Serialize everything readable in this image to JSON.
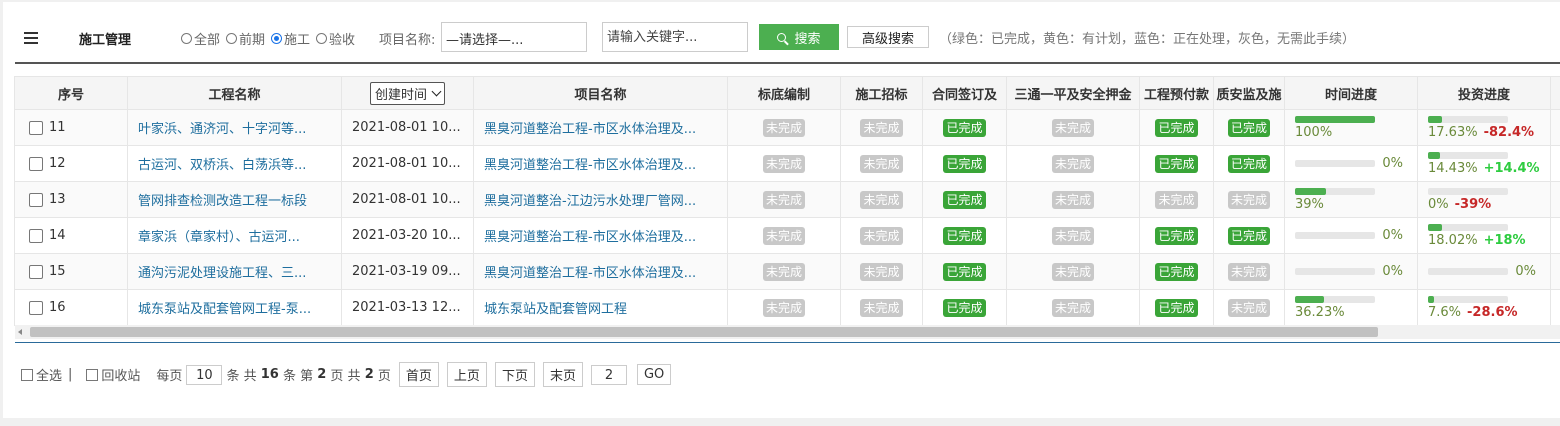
{
  "toolbar": {
    "title": "施工管理",
    "radios": [
      {
        "label": "全部",
        "checked": false
      },
      {
        "label": "前期",
        "checked": false
      },
      {
        "label": "施工",
        "checked": true
      },
      {
        "label": "验收",
        "checked": false
      }
    ],
    "project_label": "项目名称:",
    "project_select": "—请选择—...",
    "keyword_placeholder": "请输入关键字...",
    "search_label": "搜索",
    "advanced_label": "高级搜索",
    "legend": "（绿色：已完成，黄色：有计划，蓝色：正在处理，灰色，无需此手续）"
  },
  "columns": {
    "idx": "序号",
    "project": "工程名称",
    "sort_select": "创建时间",
    "item": "项目名称",
    "c1": "标底编制",
    "c2": "施工招标",
    "c3": "合同签订及",
    "c4": "三通一平及安全押金",
    "c5": "工程预付款",
    "c6": "质安监及施",
    "time": "时间进度",
    "invest": "投资进度"
  },
  "status_labels": {
    "done": "已完成",
    "todo": "未完成"
  },
  "colors": {
    "green": "#3aa538",
    "gray": "#c8c8c8",
    "bar": "#4caf50",
    "neg": "#c62828",
    "pos": "#2ecc40"
  },
  "rows": [
    {
      "idx": "11",
      "project": "叶家浜、通济河、十字河等...",
      "date": "2021-08-01 10...",
      "item": "黑臭河道整治工程-市区水体治理及...",
      "status": [
        "todo",
        "todo",
        "done",
        "todo",
        "done",
        "done"
      ],
      "time_fill": 1.0,
      "time_text": "100%",
      "time_pos": "under",
      "inv_fill": 0.1763,
      "inv_text": "17.63%",
      "delta": "-82.4%",
      "delta_sign": "neg"
    },
    {
      "idx": "12",
      "project": "古运河、双桥浜、白荡浜等...",
      "date": "2021-08-01 10...",
      "item": "黑臭河道整治工程-市区水体治理及...",
      "status": [
        "todo",
        "todo",
        "done",
        "todo",
        "done",
        "done"
      ],
      "time_fill": 0.0,
      "time_text": "0%",
      "time_pos": "right",
      "inv_fill": 0.1443,
      "inv_text": "14.43%",
      "delta": "+14.4%",
      "delta_sign": "pos"
    },
    {
      "idx": "13",
      "project": "管网排查检测改造工程一标段",
      "date": "2021-08-01 10...",
      "item": "黑臭河道整治-江边污水处理厂管网...",
      "status": [
        "todo",
        "todo",
        "done",
        "todo",
        "todo",
        "todo"
      ],
      "time_fill": 0.39,
      "time_text": "39%",
      "time_pos": "under",
      "inv_fill": 0.0,
      "inv_text": "0%",
      "delta": "-39%",
      "delta_sign": "neg"
    },
    {
      "idx": "14",
      "project": "章家浜（章家村）、古运河...",
      "date": "2021-03-20 10...",
      "item": "黑臭河道整治工程-市区水体治理及...",
      "status": [
        "todo",
        "todo",
        "done",
        "todo",
        "done",
        "done"
      ],
      "time_fill": 0.0,
      "time_text": "0%",
      "time_pos": "right",
      "inv_fill": 0.1802,
      "inv_text": "18.02%",
      "delta": "+18%",
      "delta_sign": "pos"
    },
    {
      "idx": "15",
      "project": "通沟污泥处理设施工程、三...",
      "date": "2021-03-19 09...",
      "item": "黑臭河道整治工程-市区水体治理及...",
      "status": [
        "todo",
        "todo",
        "done",
        "todo",
        "done",
        "todo"
      ],
      "time_fill": 0.0,
      "time_text": "0%",
      "time_pos": "right",
      "inv_fill": 0.0,
      "inv_text": "0%",
      "delta": "",
      "delta_sign": "",
      "inv_pos": "right"
    },
    {
      "idx": "16",
      "project": "城东泵站及配套管网工程-泵...",
      "date": "2021-03-13 12...",
      "item": "城东泵站及配套管网工程",
      "status": [
        "todo",
        "todo",
        "done",
        "todo",
        "done",
        "todo"
      ],
      "time_fill": 0.3623,
      "time_text": "36.23%",
      "time_pos": "under",
      "inv_fill": 0.076,
      "inv_text": "7.6%",
      "delta": "-28.6%",
      "delta_sign": "neg"
    }
  ],
  "pager": {
    "select_all": "全选",
    "sep": "|",
    "recycle": "回收站",
    "per_page": "每页",
    "per_page_value": "10",
    "items_label": "条 共",
    "total": "16",
    "item_unit": "条 第",
    "current": "2",
    "page_unit": "页  共",
    "pages": "2",
    "pages_unit": "页",
    "first": "首页",
    "prev": "上页",
    "next": "下页",
    "last": "末页",
    "goto_value": "2",
    "go": "GO"
  }
}
